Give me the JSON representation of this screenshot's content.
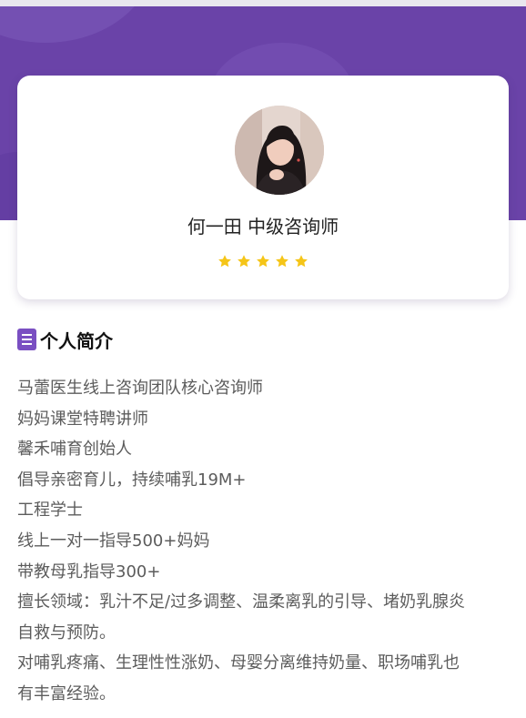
{
  "profile": {
    "name_title": "何一田 中级咨询师",
    "rating": 5,
    "rating_max": 5,
    "star_color": "#f5c518"
  },
  "section": {
    "icon": "document-list-icon",
    "title": "个人简介"
  },
  "bio_lines": [
    "马蕾医生线上咨询团队核心咨询师",
    "妈妈课堂特聘讲师",
    "馨禾哺育创始人",
    "倡导亲密育儿，持续哺乳19M+",
    "工程学士",
    "线上一对一指导500+妈妈",
    "带教母乳指导300+",
    "擅长领域：乳汁不足/过多调整、温柔离乳的引导、堵奶乳腺炎",
    "自救与预防。",
    "对哺乳疼痛、生理性性涨奶、母婴分离维持奶量、职场哺乳也",
    "有丰富经验。"
  ],
  "colors": {
    "header_purple": "#6a43a8",
    "icon_purple": "#7a4fc2"
  }
}
